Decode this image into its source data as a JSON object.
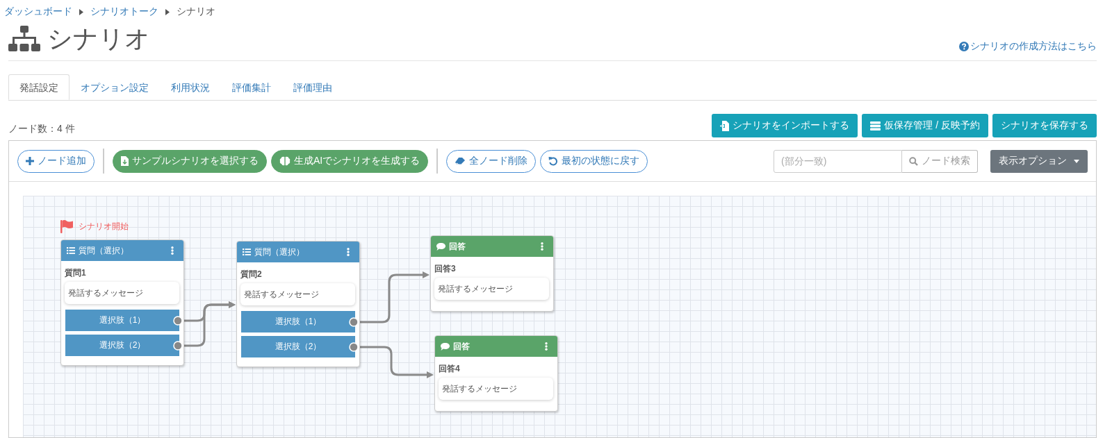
{
  "breadcrumb": [
    {
      "label": "ダッシュボード",
      "link": true
    },
    {
      "label": "シナリオトーク",
      "link": true
    },
    {
      "label": "シナリオ",
      "link": false
    }
  ],
  "page_title": "シナリオ",
  "help_link": "シナリオの作成方法はこちら",
  "tabs": [
    {
      "label": "発話設定",
      "selected": true
    },
    {
      "label": "オプション設定",
      "selected": false
    },
    {
      "label": "利用状況",
      "selected": false
    },
    {
      "label": "評価集計",
      "selected": false
    },
    {
      "label": "評価理由",
      "selected": false
    }
  ],
  "node_count": "ノード数：4 件",
  "action_buttons": [
    "シナリオをインポートする",
    "仮保存管理 / 反映予約",
    "シナリオを保存する"
  ],
  "toolbar_groups": [
    [
      {
        "label": "ノード追加",
        "kind": "outline"
      }
    ],
    [
      {
        "label": "サンプルシナリオを選択する",
        "kind": "filled"
      },
      {
        "label": "生成AIでシナリオを生成する",
        "kind": "filled"
      }
    ],
    [
      {
        "label": "全ノード削除",
        "kind": "outline"
      },
      {
        "label": "最初の状態に戻す",
        "kind": "outline"
      }
    ]
  ],
  "search": {
    "placeholder": "(部分一致)",
    "button": "ノード検索"
  },
  "display_options": "表示オプション",
  "nodes": [
    {
      "kind": "question",
      "type_label": "質問（選択）",
      "name": "質問1",
      "message": "発話するメッセージ",
      "choices": [
        "選択肢（1）",
        "選択肢（2）"
      ],
      "start_label": "シナリオ開始"
    },
    {
      "kind": "question",
      "type_label": "質問（選択）",
      "name": "質問2",
      "message": "発話するメッセージ",
      "choices": [
        "選択肢（1）",
        "選択肢（2）"
      ]
    },
    {
      "kind": "answer",
      "type_label": "回答",
      "name": "回答3",
      "message": "発話するメッセージ"
    },
    {
      "kind": "answer",
      "type_label": "回答",
      "name": "回答4",
      "message": "発話するメッセージ"
    }
  ]
}
